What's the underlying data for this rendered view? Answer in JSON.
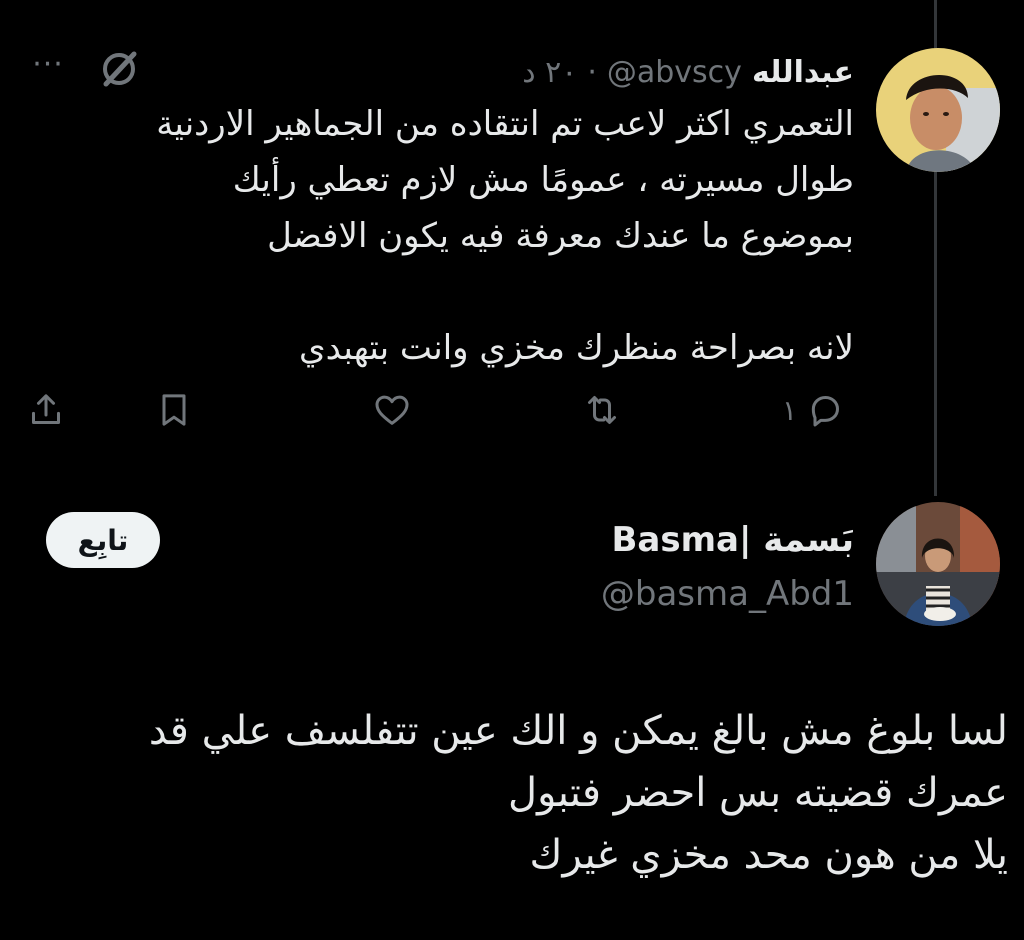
{
  "tweet1": {
    "author_name": "عبدالله",
    "author_handle": "@abvscy",
    "separator": "·",
    "time": "٢٠ د",
    "body_lines": [
      "التعمري اكثر لاعب تم انتقاده من الجماهير الاردنية",
      "طوال مسيرته ، عمومًا مش لازم تعطي رأيك",
      "بموضوع ما عندك معرفة فيه يكون الافضل",
      "",
      "لانه بصراحة منظرك مخزي وانت بتهبدي"
    ],
    "more_label": "···",
    "actions": {
      "reply_count": "١",
      "icons": [
        "reply-icon",
        "retweet-icon",
        "like-icon",
        "bookmark-icon",
        "share-icon"
      ]
    }
  },
  "tweet2": {
    "author_name": "Basma| بَسمة",
    "author_handle": "@basma_Abd1",
    "follow_label": "تابِع",
    "body_lines": [
      "لسا بلوغ مش بالغ يمكن  و الك عين تتفلسف علي قد",
      "عمرك قضيته بس احضر فتبول",
      "يلا من هون محد مخزي غيرك"
    ]
  },
  "colors": {
    "background": "#000000",
    "primary_text": "#e7e9ea",
    "secondary_text": "#71767b",
    "thread_line": "#333639",
    "follow_bg": "#eff3f4"
  }
}
